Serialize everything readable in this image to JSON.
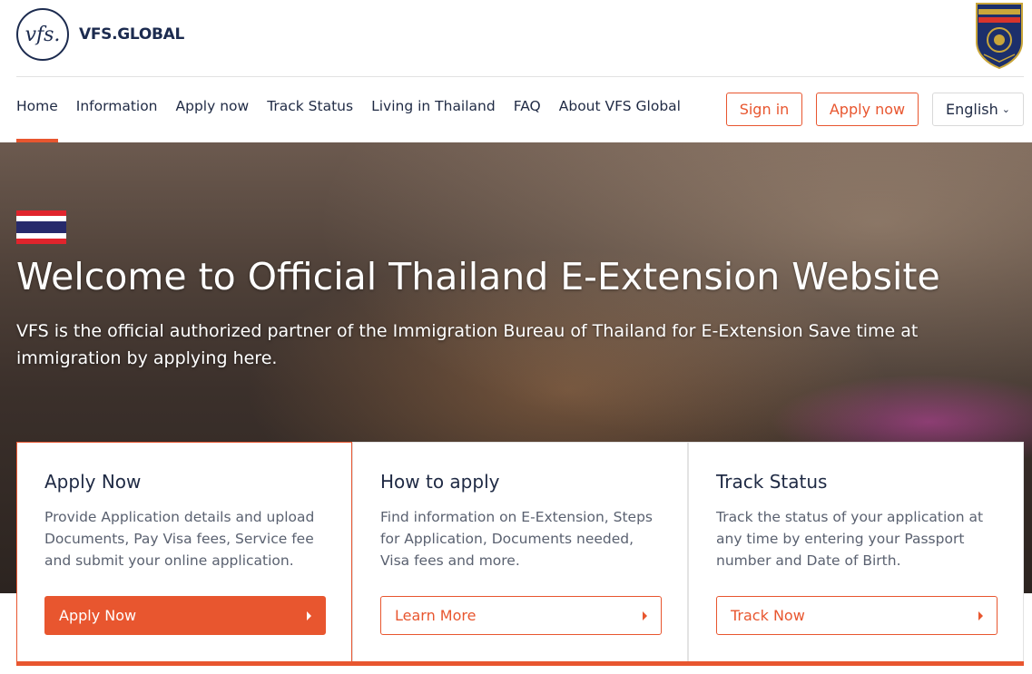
{
  "brand": {
    "logo_mark": "vfs.",
    "name": "VFS.GLOBAL",
    "emblem_icon": "royal-thai-police-emblem"
  },
  "nav": {
    "items": [
      {
        "label": "Home",
        "active": true
      },
      {
        "label": "Information"
      },
      {
        "label": "Apply now"
      },
      {
        "label": "Track Status"
      },
      {
        "label": "Living in Thailand"
      },
      {
        "label": "FAQ"
      },
      {
        "label": "About VFS Global"
      }
    ],
    "sign_in": "Sign in",
    "apply_now": "Apply now",
    "language": "English"
  },
  "hero": {
    "flag_icon": "thailand-flag",
    "title": "Welcome to Official Thailand E-Extension Website",
    "subtitle": "VFS is the official authorized partner of the Immigration Bureau of Thailand for E-Extension Save time at immigration by applying here."
  },
  "cards": [
    {
      "title": "Apply Now",
      "description": "Provide Application details and upload Documents, Pay Visa fees, Service fee and submit your online application.",
      "button": "Apply Now"
    },
    {
      "title": "How to apply",
      "description": "Find information on E-Extension, Steps for Application, Documents needed, Visa fees and more.",
      "button": "Learn More"
    },
    {
      "title": "Track Status",
      "description": "Track the status of your application at any time by entering your Passport number and Date of Birth.",
      "button": "Track Now"
    }
  ],
  "colors": {
    "accent": "#e8562f",
    "navy": "#1c2b4f",
    "text": "#1f2a44",
    "muted": "#5a6170"
  }
}
